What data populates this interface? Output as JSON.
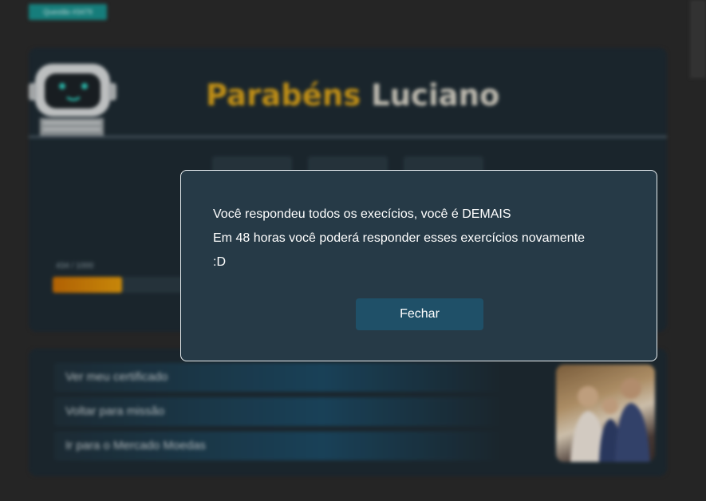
{
  "question_tag": "Questão #3479",
  "header": {
    "greeting": "Parabéns",
    "name": "Luciano"
  },
  "progress": {
    "label": "434 / 1000",
    "current": 434,
    "max": 1000
  },
  "links": [
    {
      "label": "Ver meu certificado"
    },
    {
      "label": "Voltar para missão"
    },
    {
      "label": "Ir para o Mercado Moedas"
    }
  ],
  "modal": {
    "line1": "Você respondeu todos os execícios, você é DEMAIS",
    "line2": "Em 48 horas você poderá responder esses exercícios novamente",
    "line3": ":D",
    "close_label": "Fechar"
  },
  "colors": {
    "accent_gold": "#d9a21a",
    "modal_bg": "#263a47",
    "button_bg": "#1f5068",
    "tag_bg": "#1a8f8c"
  },
  "icons": {
    "mascot": "robot-mascot-icon"
  }
}
